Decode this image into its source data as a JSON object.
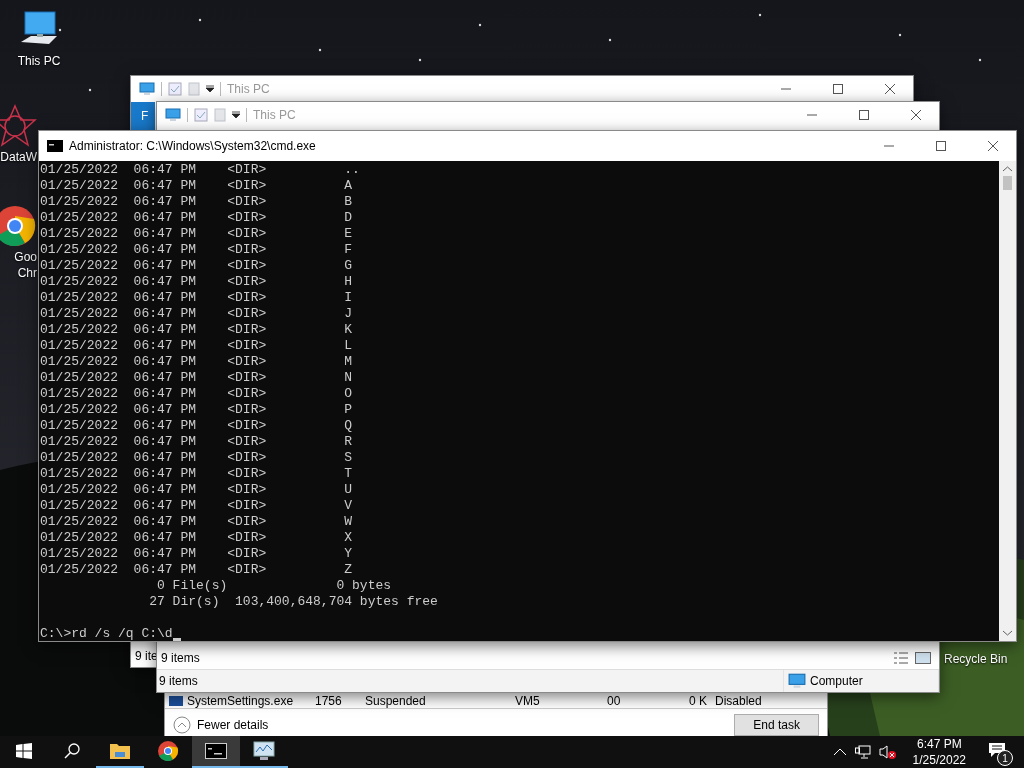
{
  "desktop_icons": [
    {
      "kind": "pc",
      "lines": [
        "This PC"
      ]
    },
    {
      "kind": "star",
      "lines": [
        "DataW"
      ]
    },
    {
      "kind": "chrome",
      "lines": [
        "Goo",
        "Chr"
      ]
    }
  ],
  "recycle_bin": {
    "label": "Recycle Bin"
  },
  "task_manager": {
    "row": [
      "SystemSettings.exe",
      "1756",
      "Suspended",
      "VM5",
      "00",
      "0 K",
      "Disabled"
    ],
    "fewer_details": "Fewer details",
    "end_task": "End task"
  },
  "explorer_back": {
    "title": "This PC",
    "ribbon_tab": "F",
    "status": "9 ite"
  },
  "explorer_front": {
    "title": "This PC",
    "status": "9 items",
    "details": "9 items",
    "location": "Computer"
  },
  "cmd": {
    "title": "Administrator: C:\\Windows\\System32\\cmd.exe",
    "lines": [
      "01/25/2022  06:47 PM    <DIR>          ..",
      "01/25/2022  06:47 PM    <DIR>          A",
      "01/25/2022  06:47 PM    <DIR>          B",
      "01/25/2022  06:47 PM    <DIR>          D",
      "01/25/2022  06:47 PM    <DIR>          E",
      "01/25/2022  06:47 PM    <DIR>          F",
      "01/25/2022  06:47 PM    <DIR>          G",
      "01/25/2022  06:47 PM    <DIR>          H",
      "01/25/2022  06:47 PM    <DIR>          I",
      "01/25/2022  06:47 PM    <DIR>          J",
      "01/25/2022  06:47 PM    <DIR>          K",
      "01/25/2022  06:47 PM    <DIR>          L",
      "01/25/2022  06:47 PM    <DIR>          M",
      "01/25/2022  06:47 PM    <DIR>          N",
      "01/25/2022  06:47 PM    <DIR>          O",
      "01/25/2022  06:47 PM    <DIR>          P",
      "01/25/2022  06:47 PM    <DIR>          Q",
      "01/25/2022  06:47 PM    <DIR>          R",
      "01/25/2022  06:47 PM    <DIR>          S",
      "01/25/2022  06:47 PM    <DIR>          T",
      "01/25/2022  06:47 PM    <DIR>          U",
      "01/25/2022  06:47 PM    <DIR>          V",
      "01/25/2022  06:47 PM    <DIR>          W",
      "01/25/2022  06:47 PM    <DIR>          X",
      "01/25/2022  06:47 PM    <DIR>          Y",
      "01/25/2022  06:47 PM    <DIR>          Z",
      "               0 File(s)              0 bytes",
      "              27 Dir(s)  103,400,648,704 bytes free"
    ],
    "prompt": "C:\\>rd /s /q C:\\d"
  },
  "taskbar": {
    "apps": [
      {
        "kind": "explorer",
        "running": true,
        "selected": false
      },
      {
        "kind": "chrome",
        "running": false,
        "selected": false
      },
      {
        "kind": "cmd",
        "running": true,
        "selected": true
      },
      {
        "kind": "taskmgr",
        "running": true,
        "selected": false
      }
    ],
    "volume_muted": true,
    "time": "6:47 PM",
    "date": "1/25/2022",
    "notifications": "1"
  }
}
